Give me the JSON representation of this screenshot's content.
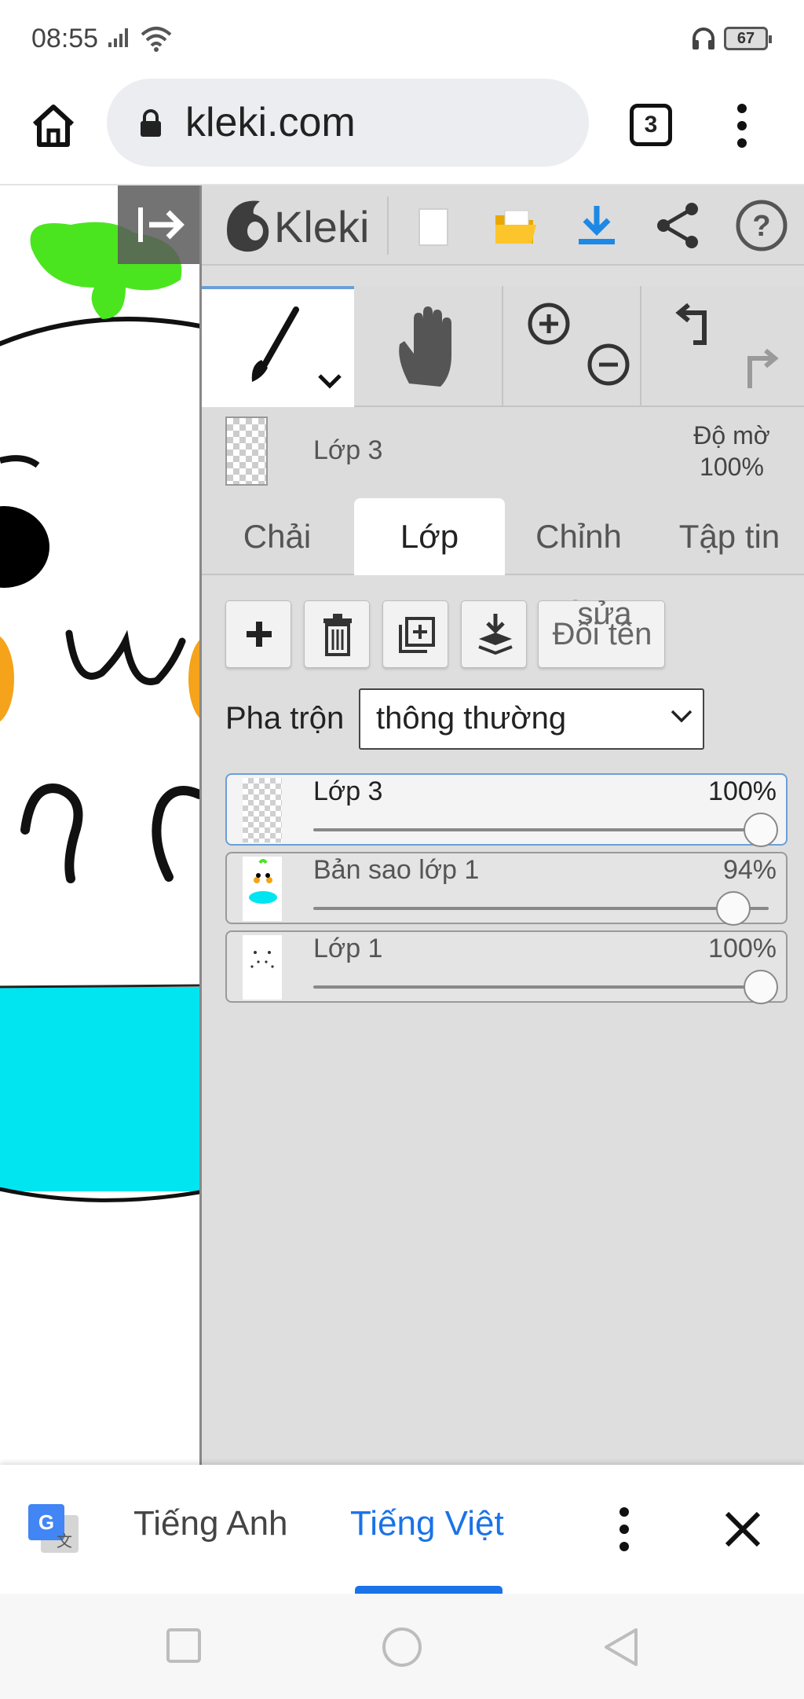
{
  "status_bar": {
    "time": "08:55",
    "battery": "67"
  },
  "browser": {
    "url": "kleki.com",
    "tab_count": "3"
  },
  "app": {
    "name": "Kleki"
  },
  "layer_info": {
    "name": "Lớp 3",
    "opacity_label": "Độ mờ",
    "opacity_value": "100%"
  },
  "tabs": [
    {
      "label": "Chải",
      "active": false
    },
    {
      "label": "Lớp",
      "active": true
    },
    {
      "label": "Chỉnh sửa",
      "active": false
    },
    {
      "label": "Tập tin",
      "active": false
    }
  ],
  "layer_buttons": {
    "rename_overlap": "sửa",
    "rename_label": "Đổi tên"
  },
  "blend": {
    "label": "Pha trộn",
    "value": "thông thường"
  },
  "layers": [
    {
      "name": "Lớp 3",
      "opacity_text": "100%",
      "opacity": 1.0,
      "selected": true
    },
    {
      "name": "Bản sao lớp 1",
      "opacity_text": "94%",
      "opacity": 0.94,
      "selected": false
    },
    {
      "name": "Lớp 1",
      "opacity_text": "100%",
      "opacity": 1.0,
      "selected": false
    }
  ],
  "translate": {
    "source_lang": "Tiếng Anh",
    "target_lang": "Tiếng Việt"
  },
  "colors": {
    "accent": "#1a73e8",
    "selected_layer_border": "#6b9fd8",
    "download_icon": "#1e88e5",
    "canvas_cyan": "#00e5f0",
    "canvas_green": "#4be51f",
    "canvas_orange": "#f5a31a"
  }
}
